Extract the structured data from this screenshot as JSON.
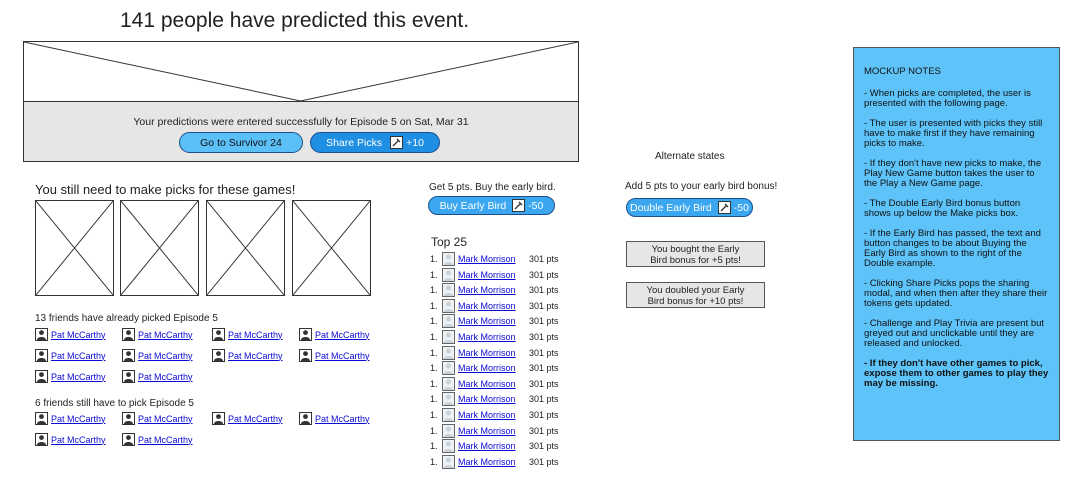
{
  "headline": "141 people have predicted this event.",
  "banner": {
    "success_text": "Your predictions were entered successfully for Episode 5 on Sat, Mar 31",
    "go_button": "Go to Survivor 24",
    "share_button": "Share Picks",
    "share_bonus": "+10"
  },
  "games": {
    "title": "You still need to make picks for these games!"
  },
  "friends_picked": {
    "title": "13 friends have already picked Episode 5",
    "names": [
      "Pat McCarthy",
      "Pat McCarthy",
      "Pat McCarthy",
      "Pat McCarthy",
      "Pat McCarthy",
      "Pat McCarthy",
      "Pat McCarthy",
      "Pat McCarthy",
      "Pat McCarthy",
      "Pat McCarthy"
    ]
  },
  "friends_pending": {
    "title": "6 friends still have to pick Episode 5",
    "names": [
      "Pat McCarthy",
      "Pat McCarthy",
      "Pat McCarthy",
      "Pat McCarthy",
      "Pat McCarthy",
      "Pat McCarthy"
    ]
  },
  "early_bird": {
    "prompt": "Get 5 pts.  Buy the early bird.",
    "button": "Buy Early Bird",
    "cost": "-50"
  },
  "top25": {
    "title": "Top 25",
    "rows": [
      {
        "rank": "1.",
        "name": "Mark Morrison",
        "pts": "301 pts"
      },
      {
        "rank": "1.",
        "name": "Mark Morrison",
        "pts": "301 pts"
      },
      {
        "rank": "1.",
        "name": "Mark Morrison",
        "pts": "301 pts"
      },
      {
        "rank": "1.",
        "name": "Mark Morrison",
        "pts": "301 pts"
      },
      {
        "rank": "1.",
        "name": "Mark Morrison",
        "pts": "301 pts"
      },
      {
        "rank": "1.",
        "name": "Mark Morrison",
        "pts": "301 pts"
      },
      {
        "rank": "1.",
        "name": "Mark Morrison",
        "pts": "301 pts"
      },
      {
        "rank": "1.",
        "name": "Mark Morrison",
        "pts": "301 pts"
      },
      {
        "rank": "1.",
        "name": "Mark Morrison",
        "pts": "301 pts"
      },
      {
        "rank": "1.",
        "name": "Mark Morrison",
        "pts": "301 pts"
      },
      {
        "rank": "1.",
        "name": "Mark Morrison",
        "pts": "301 pts"
      },
      {
        "rank": "1.",
        "name": "Mark Morrison",
        "pts": "301 pts"
      },
      {
        "rank": "1.",
        "name": "Mark Morrison",
        "pts": "301 pts"
      },
      {
        "rank": "1.",
        "name": "Mark Morrison",
        "pts": "301 pts"
      }
    ]
  },
  "alternate": {
    "title": "Alternate states",
    "prompt": "Add 5 pts to your early bird bonus!",
    "double_button": "Double Early Bird",
    "double_cost": "-50",
    "bought_line1": "You bought the Early",
    "bought_line2": "Bird bonus for +5 pts!",
    "doubled_line1": "You doubled your Early",
    "doubled_line2": "Bird bonus for +10 pts!"
  },
  "notes": {
    "heading": "MOCKUP NOTES",
    "items": [
      "- When picks are completed, the user is presented with the following page.",
      "- The user is presented with picks they still have to make first if they have remaining picks to make.",
      "- If they don't have new picks to make, the Play New Game button takes the user to the Play a New Game page.",
      "- The Double Early Bird bonus button shows up below the Make picks box.",
      "- If the Early Bird has passed, the text and button changes to be about Buying the Early Bird as shown to the right of the Double example.",
      "- Clicking Share Picks pops the sharing modal, and when then after they share their tokens gets updated.",
      "- Challenge and Play Trivia are present but greyed out and unclickable until they are released and unlocked."
    ],
    "bold_item": "- If they don't have other games to pick, expose them to other games to play they may be missing."
  },
  "colors": {
    "pill_light": "#5bc0f7",
    "pill_dark": "#1f8fe3",
    "notes_bg": "#5ec3f8",
    "link": "#0a0ad6"
  }
}
